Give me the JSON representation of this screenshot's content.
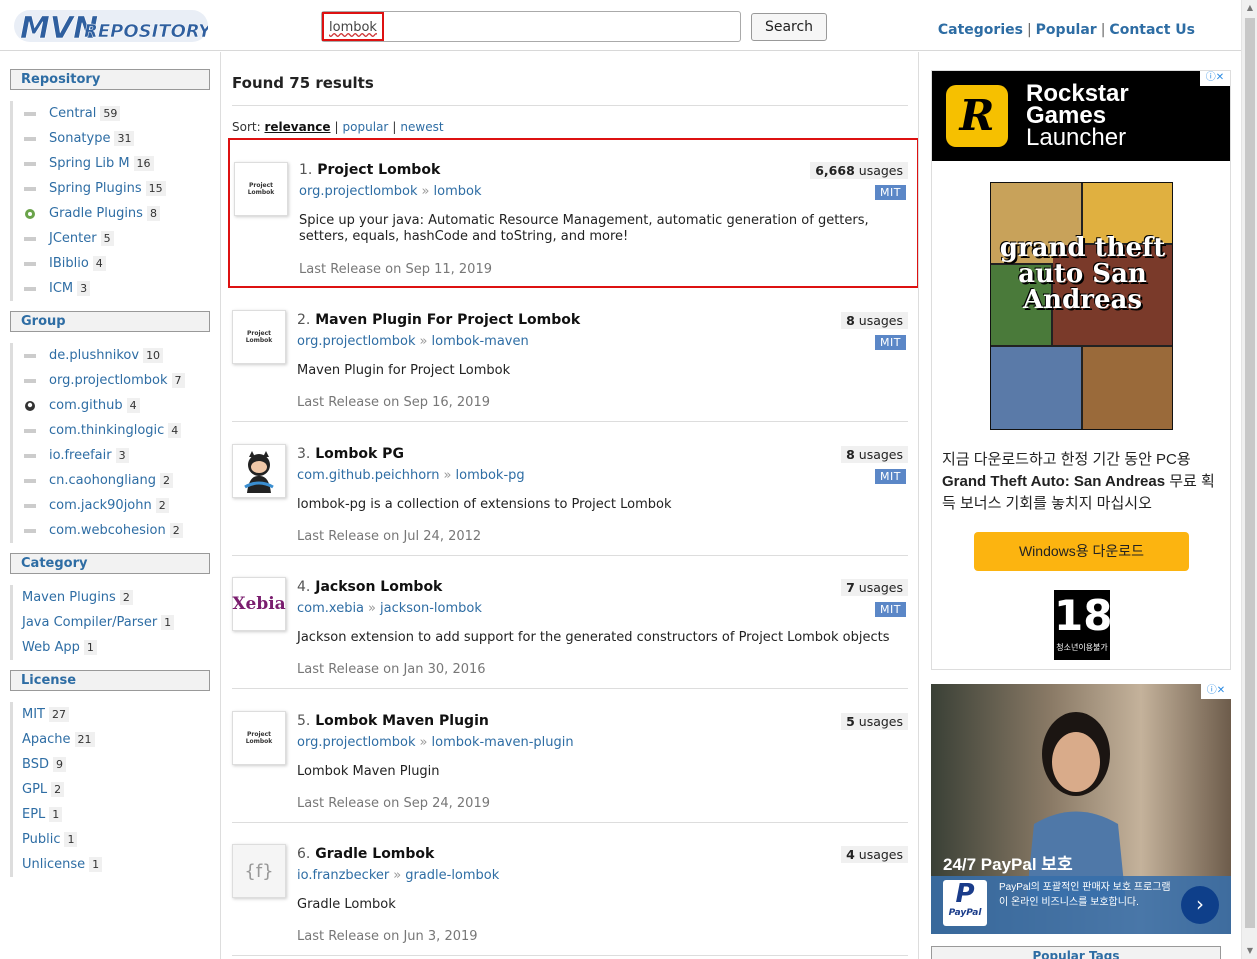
{
  "header": {
    "logo_text": "MVNREPOSITORY",
    "search_value": "lombok",
    "search_button": "Search",
    "links": [
      "Categories",
      "Popular",
      "Contact Us"
    ]
  },
  "sidebar": {
    "repository": {
      "heading": "Repository",
      "items": [
        {
          "label": "Central",
          "count": "59"
        },
        {
          "label": "Sonatype",
          "count": "31"
        },
        {
          "label": "Spring Lib M",
          "count": "16"
        },
        {
          "label": "Spring Plugins",
          "count": "15"
        },
        {
          "label": "Gradle Plugins",
          "count": "8"
        },
        {
          "label": "JCenter",
          "count": "5"
        },
        {
          "label": "IBiblio",
          "count": "4"
        },
        {
          "label": "ICM",
          "count": "3"
        }
      ]
    },
    "group": {
      "heading": "Group",
      "items": [
        {
          "label": "de.plushnikov",
          "count": "10"
        },
        {
          "label": "org.projectlombok",
          "count": "7"
        },
        {
          "label": "com.github",
          "count": "4"
        },
        {
          "label": "com.thinkinglogic",
          "count": "4"
        },
        {
          "label": "io.freefair",
          "count": "3"
        },
        {
          "label": "cn.caohongliang",
          "count": "2"
        },
        {
          "label": "com.jack90john",
          "count": "2"
        },
        {
          "label": "com.webcohesion",
          "count": "2"
        }
      ]
    },
    "category": {
      "heading": "Category",
      "items": [
        {
          "label": "Maven Plugins",
          "count": "2"
        },
        {
          "label": "Java Compiler/Parser",
          "count": "1"
        },
        {
          "label": "Web App",
          "count": "1"
        }
      ]
    },
    "license": {
      "heading": "License",
      "items": [
        {
          "label": "MIT",
          "count": "27"
        },
        {
          "label": "Apache",
          "count": "21"
        },
        {
          "label": "BSD",
          "count": "9"
        },
        {
          "label": "GPL",
          "count": "2"
        },
        {
          "label": "EPL",
          "count": "1"
        },
        {
          "label": "Public",
          "count": "1"
        },
        {
          "label": "Unlicense",
          "count": "1"
        }
      ]
    }
  },
  "main": {
    "found": "Found 75 results",
    "sort_label": "Sort:",
    "sort_options": [
      "relevance",
      "popular",
      "newest"
    ],
    "results": [
      {
        "num": "1.",
        "title": "Project Lombok",
        "group": "org.projectlombok",
        "artifact": "lombok",
        "usages": "6,668",
        "usages_label": "usages",
        "license": "MIT",
        "desc": "Spice up your java: Automatic Resource Management, automatic generation of getters, setters, equals, hashCode and toString, and more!",
        "release": "Last Release on Sep 11, 2019",
        "logo": "Project Lombok"
      },
      {
        "num": "2.",
        "title": "Maven Plugin For Project Lombok",
        "group": "org.projectlombok",
        "artifact": "lombok-maven",
        "usages": "8",
        "usages_label": "usages",
        "license": "MIT",
        "desc": "Maven Plugin for Project Lombok",
        "release": "Last Release on Sep 16, 2019",
        "logo": "Project Lombok"
      },
      {
        "num": "3.",
        "title": "Lombok PG",
        "group": "com.github.peichhorn",
        "artifact": "lombok-pg",
        "usages": "8",
        "usages_label": "usages",
        "license": "MIT",
        "desc": "lombok-pg is a collection of extensions to Project Lombok",
        "release": "Last Release on Jul 24, 2012",
        "logo": ""
      },
      {
        "num": "4.",
        "title": "Jackson Lombok",
        "group": "com.xebia",
        "artifact": "jackson-lombok",
        "usages": "7",
        "usages_label": "usages",
        "license": "MIT",
        "desc": "Jackson extension to add support for the generated constructors of Project Lombok objects",
        "release": "Last Release on Jan 30, 2016",
        "logo": "Xebia"
      },
      {
        "num": "5.",
        "title": "Lombok Maven Plugin",
        "group": "org.projectlombok",
        "artifact": "lombok-maven-plugin",
        "usages": "5",
        "usages_label": "usages",
        "license": "",
        "desc": "Lombok Maven Plugin",
        "release": "Last Release on Sep 24, 2019",
        "logo": "Project Lombok"
      },
      {
        "num": "6.",
        "title": "Gradle Lombok",
        "group": "io.franzbecker",
        "artifact": "gradle-lombok",
        "usages": "4",
        "usages_label": "usages",
        "license": "",
        "desc": "Gradle Lombok",
        "release": "Last Release on Jun 3, 2019",
        "logo": "{f}"
      }
    ]
  },
  "ads": {
    "ad1": {
      "brand_line1": "Rockstar",
      "brand_line2": "Games",
      "brand_line3": "Launcher",
      "r_logo": "R",
      "cover_title": "grand theft auto San Andreas",
      "body_prefix": "지금 다운로드하고 한정 기간 동안 PC용",
      "body_game": "Grand Theft Auto: San Andreas",
      "body_suffix": "무료 획득 보너스 기회를 놓치지 마십시오",
      "button": "Windows용 다운로드",
      "rating_big": "18",
      "rating_small": "청소년이용불가"
    },
    "ad2": {
      "headline": "24/7 PayPal 보호",
      "pp_label": "PayPal",
      "text": "PayPal의 포괄적인 판매자 보호 프로그램이 온라인 비즈니스를 보호합니다.",
      "arrow": "›"
    },
    "popular_tags": "Popular Tags"
  },
  "colors": {
    "link": "#2e6da4",
    "highlight": "#dd1111",
    "license_badge": "#5b87c7"
  }
}
